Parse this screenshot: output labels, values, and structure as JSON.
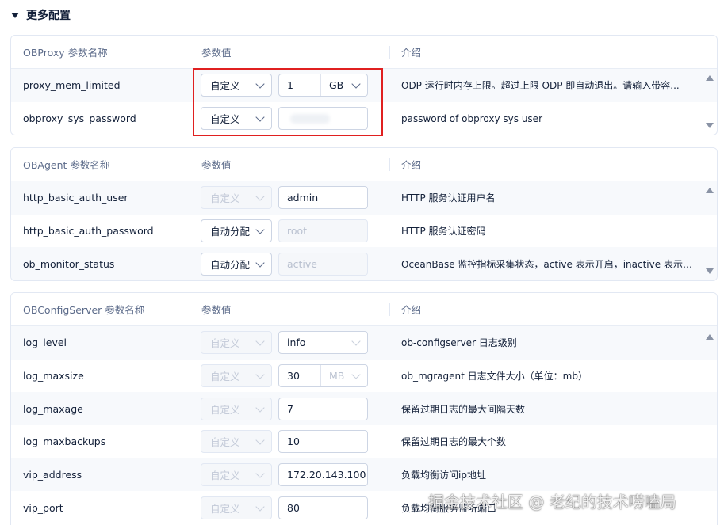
{
  "section": {
    "title": "更多配置"
  },
  "panels": [
    {
      "head": {
        "name": "OBProxy 参数名称",
        "value": "参数值",
        "desc": "介绍"
      },
      "rows": [
        {
          "name": "proxy_mem_limited",
          "mode": "自定义",
          "value": "1",
          "unit": "GB",
          "desc": "ODP 运行时内存上限。超过上限 ODP 即自动退出。请输入带容..."
        },
        {
          "name": "obproxy_sys_password",
          "mode": "自定义",
          "value": "",
          "desc": "password of obproxy sys user"
        }
      ]
    },
    {
      "head": {
        "name": "OBAgent 参数名称",
        "value": "参数值",
        "desc": "介绍"
      },
      "rows": [
        {
          "name": "http_basic_auth_user",
          "mode": "自定义",
          "value": "admin",
          "desc": "HTTP 服务认证用户名"
        },
        {
          "name": "http_basic_auth_password",
          "mode": "自动分配",
          "value": "root",
          "desc": "HTTP 服务认证密码"
        },
        {
          "name": "ob_monitor_status",
          "mode": "自动分配",
          "value": "active",
          "desc": "OceanBase 监控指标采集状态，active 表示开启，inactive 表示关..."
        }
      ]
    },
    {
      "head": {
        "name": "OBConfigServer 参数名称",
        "value": "参数值",
        "desc": "介绍"
      },
      "rows": [
        {
          "name": "log_level",
          "mode": "自定义",
          "value": "info",
          "desc": "ob-configserver 日志级别"
        },
        {
          "name": "log_maxsize",
          "mode": "自定义",
          "value": "30",
          "unit": "MB",
          "desc": "ob_mgragent 日志文件大小（单位：mb）"
        },
        {
          "name": "log_maxage",
          "mode": "自定义",
          "value": "7",
          "desc": "保留过期日志的最大间隔天数"
        },
        {
          "name": "log_maxbackups",
          "mode": "自定义",
          "value": "10",
          "desc": "保留过期日志的最大个数"
        },
        {
          "name": "vip_address",
          "mode": "自定义",
          "value": "172.20.143.100",
          "desc": "负载均衡访问ip地址"
        },
        {
          "name": "vip_port",
          "mode": "自定义",
          "value": "80",
          "desc": "负载均衡服务监听端口"
        }
      ]
    }
  ],
  "watermark": "掘金技术社区 @ 老纪的技术唠嗑局",
  "colors": {
    "highlight": "#e02020",
    "text": "#132039",
    "muted": "#5c6b8a"
  }
}
